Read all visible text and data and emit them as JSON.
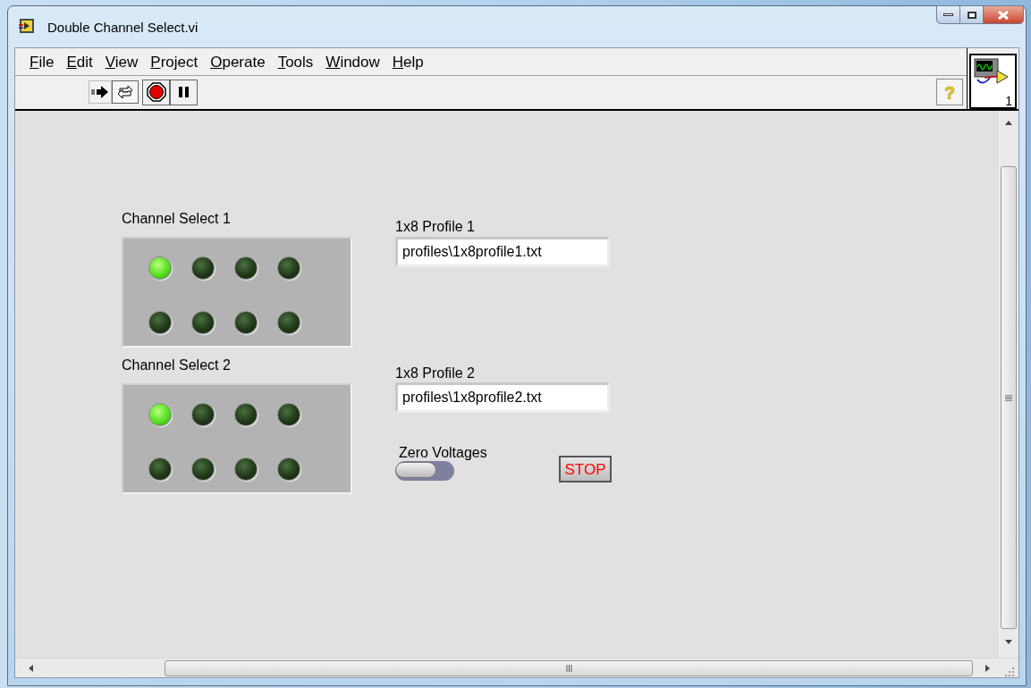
{
  "window": {
    "title": "Double Channel Select.vi"
  },
  "menu": [
    "File",
    "Edit",
    "View",
    "Project",
    "Operate",
    "Tools",
    "Window",
    "Help"
  ],
  "channel_selects": [
    {
      "label": "Channel Select 1",
      "leds": [
        {
          "on": true
        },
        {
          "on": false
        },
        {
          "on": false
        },
        {
          "on": false
        },
        {
          "on": false
        },
        {
          "on": false
        },
        {
          "on": false
        },
        {
          "on": false
        }
      ]
    },
    {
      "label": "Channel Select 2",
      "leds": [
        {
          "on": true
        },
        {
          "on": false
        },
        {
          "on": false
        },
        {
          "on": false
        },
        {
          "on": false
        },
        {
          "on": false
        },
        {
          "on": false
        },
        {
          "on": false
        }
      ]
    }
  ],
  "profiles": [
    {
      "label": "1x8 Profile 1",
      "value": "profiles\\1x8profile1.txt"
    },
    {
      "label": "1x8 Profile 2",
      "value": "profiles\\1x8profile2.txt"
    }
  ],
  "zero_voltages": {
    "label": "Zero Voltages",
    "on": false
  },
  "stop_button": {
    "label": "STOP"
  },
  "help_button": {
    "label": "?"
  },
  "icon_pane": {
    "label": "1"
  }
}
